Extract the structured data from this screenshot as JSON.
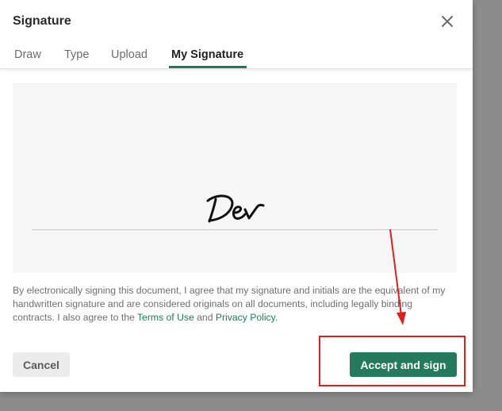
{
  "dialog": {
    "title": "Signature",
    "tabs": [
      {
        "label": "Draw",
        "active": false
      },
      {
        "label": "Type",
        "active": false
      },
      {
        "label": "Upload",
        "active": false
      },
      {
        "label": "My Signature",
        "active": true
      }
    ],
    "signature_text": "Dev",
    "legal": {
      "text_before": "By electronically signing this document, I agree that my signature and initials are the equivalent of my handwritten signature and are considered originals on all documents, including legally binding contracts. I also agree to the ",
      "terms_link": "Terms of Use",
      "and": " and ",
      "privacy_link": "Privacy Policy",
      "end": "."
    },
    "buttons": {
      "cancel_label": "Cancel",
      "accept_label": "Accept and sign"
    }
  },
  "colors": {
    "accent": "#247a5d",
    "annotation": "#e01e1e"
  },
  "icons": {
    "close": "close-icon"
  }
}
